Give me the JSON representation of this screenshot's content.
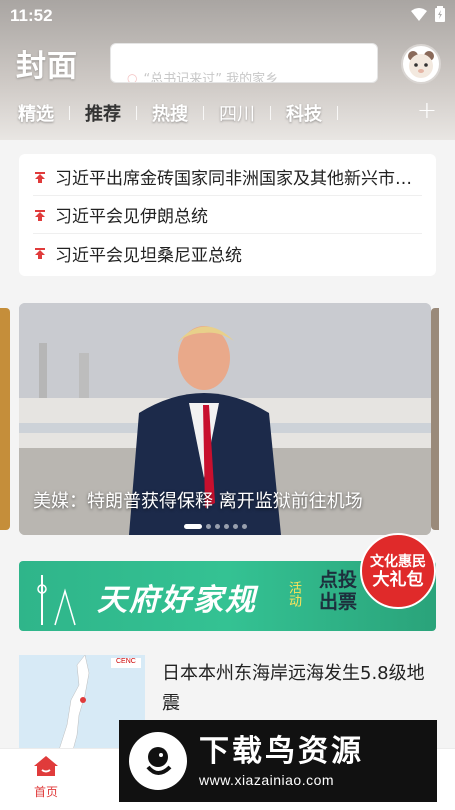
{
  "status_bar": {
    "time": "11:52",
    "wifi_icon": "wifi-icon",
    "battery_icon": "battery-icon"
  },
  "header": {
    "logo": "封面",
    "search_hint": "“总书记来过” 我的家乡",
    "avatar_icon": "bear-avatar-icon"
  },
  "tabs": [
    {
      "label": "精选",
      "active": false
    },
    {
      "label": "推荐",
      "active": true
    },
    {
      "label": "热搜",
      "active": false
    },
    {
      "label": "四川",
      "active": false
    },
    {
      "label": "科技",
      "active": false
    }
  ],
  "tab_add_label": "+",
  "headlines": [
    "习近平出席金砖国家同非洲国家及其他新兴市场国家领导人对话会",
    "习近平会见伊朗总统",
    "习近平会见坦桑尼亚总统"
  ],
  "carousel": {
    "caption": "美媒：特朗普获得保释 离开监狱前往机场",
    "active_index": 0,
    "total": 6
  },
  "banner": {
    "title": "天府好家规",
    "sub": "活动",
    "vote": "点投出票",
    "gift_line1": "文化惠民",
    "gift_line2": "大礼包"
  },
  "news_item": {
    "title": "日本本州东海岸远海发生5.8级地震",
    "thumb_label": "CENC"
  },
  "bottom_nav": {
    "home_label": "首页"
  },
  "watermark": {
    "title": "下载鸟资源",
    "url": "www.xiazainiao.com"
  },
  "colors": {
    "accent": "#e03b3b",
    "banner_green": "#34c293"
  }
}
